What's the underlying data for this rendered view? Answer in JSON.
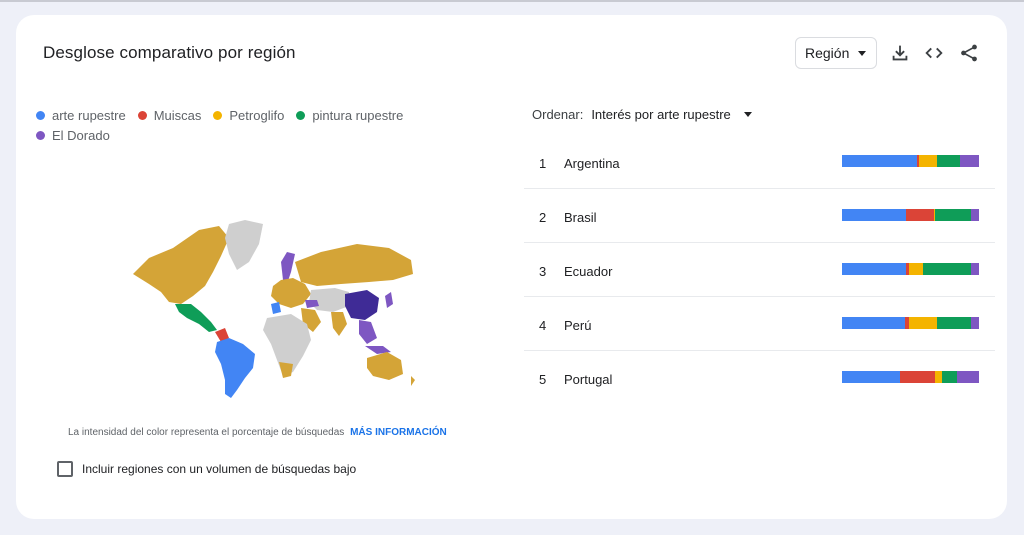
{
  "card": {
    "title": "Desglose comparativo por región",
    "region_select_label": "Región"
  },
  "colors": {
    "arte_rupestre": "#4285f4",
    "muiscas": "#db4437",
    "petroglifo": "#f4b400",
    "pintura_rupestre": "#0f9d58",
    "el_dorado": "#7e57c2"
  },
  "legend": [
    {
      "label": "arte rupestre",
      "color": "#4285f4"
    },
    {
      "label": "Muiscas",
      "color": "#db4437"
    },
    {
      "label": "Petroglifo",
      "color": "#f4b400"
    },
    {
      "label": "pintura rupestre",
      "color": "#0f9d58"
    },
    {
      "label": "El Dorado",
      "color": "#7e57c2"
    }
  ],
  "icons": [
    "download-icon",
    "embed-code-icon",
    "share-icon",
    "world-map"
  ],
  "info": {
    "text": "La intensidad del color representa el porcentaje de búsquedas",
    "link": "MÁS INFORMACIÓN"
  },
  "include_low_volume": {
    "label": "Incluir regiones con un volumen de búsquedas bajo",
    "checked": false
  },
  "sort": {
    "label": "Ordenar:",
    "value": "Interés por arte rupestre"
  },
  "ranking": [
    {
      "rank": "1",
      "name": "Argentina",
      "shares": [
        55,
        1,
        13,
        17,
        14
      ]
    },
    {
      "rank": "2",
      "name": "Brasil",
      "shares": [
        47,
        20,
        1,
        26,
        6
      ]
    },
    {
      "rank": "3",
      "name": "Ecuador",
      "shares": [
        47,
        2,
        10,
        35,
        6
      ]
    },
    {
      "rank": "4",
      "name": "Perú",
      "shares": [
        46,
        3,
        20,
        25,
        6
      ]
    },
    {
      "rank": "5",
      "name": "Portugal",
      "shares": [
        42,
        26,
        5,
        11,
        16
      ]
    }
  ]
}
